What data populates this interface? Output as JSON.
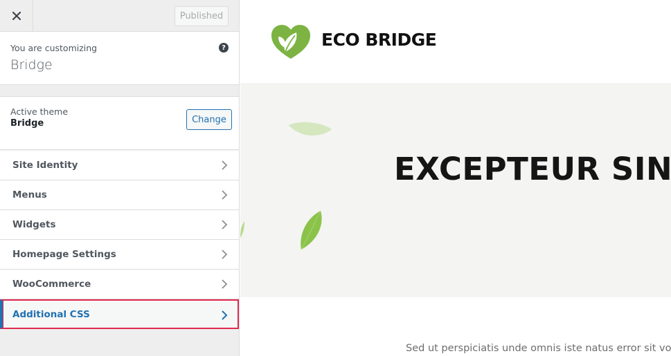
{
  "sidebar": {
    "close_label": "Close",
    "published_label": "Published",
    "customizing_label": "You are customizing",
    "site_name": "Bridge",
    "help_icon": "?",
    "active_theme_label": "Active theme",
    "active_theme_name": "Bridge",
    "change_label": "Change",
    "items": [
      {
        "label": "Site Identity"
      },
      {
        "label": "Menus"
      },
      {
        "label": "Widgets"
      },
      {
        "label": "Homepage Settings"
      },
      {
        "label": "WooCommerce"
      },
      {
        "label": "Additional CSS",
        "active": true
      }
    ]
  },
  "preview": {
    "logo_text": "ECO BRIDGE",
    "hero_title": "EXCEPTEUR SINT",
    "body_text": "Sed ut perspiciatis unde omnis iste natus error sit volup"
  },
  "colors": {
    "accent": "#2271b1",
    "highlight_border": "#e0294f",
    "brand_green": "#7cb342"
  }
}
